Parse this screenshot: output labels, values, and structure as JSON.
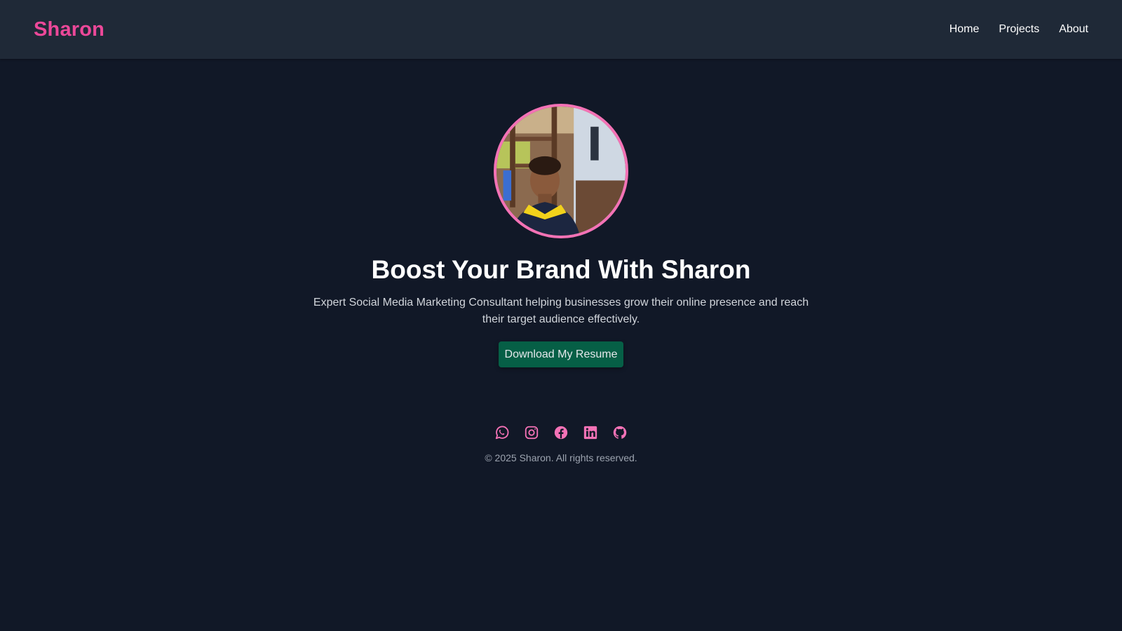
{
  "header": {
    "brand": "Sharon",
    "nav": [
      {
        "label": "Home"
      },
      {
        "label": "Projects"
      },
      {
        "label": "About"
      }
    ]
  },
  "hero": {
    "headline": "Boost Your Brand With Sharon",
    "subtitle": "Expert Social Media Marketing Consultant helping businesses grow their online presence and reach their target audience effectively.",
    "cta_label": "Download My Resume"
  },
  "footer": {
    "social_icons": [
      "whatsapp-icon",
      "instagram-icon",
      "facebook-icon",
      "linkedin-icon",
      "github-icon"
    ],
    "copyright": "© 2025 Sharon. All rights reserved."
  },
  "colors": {
    "accent": "#ec4899",
    "background": "#111827",
    "navbar": "#1f2937",
    "button": "#065f46"
  }
}
